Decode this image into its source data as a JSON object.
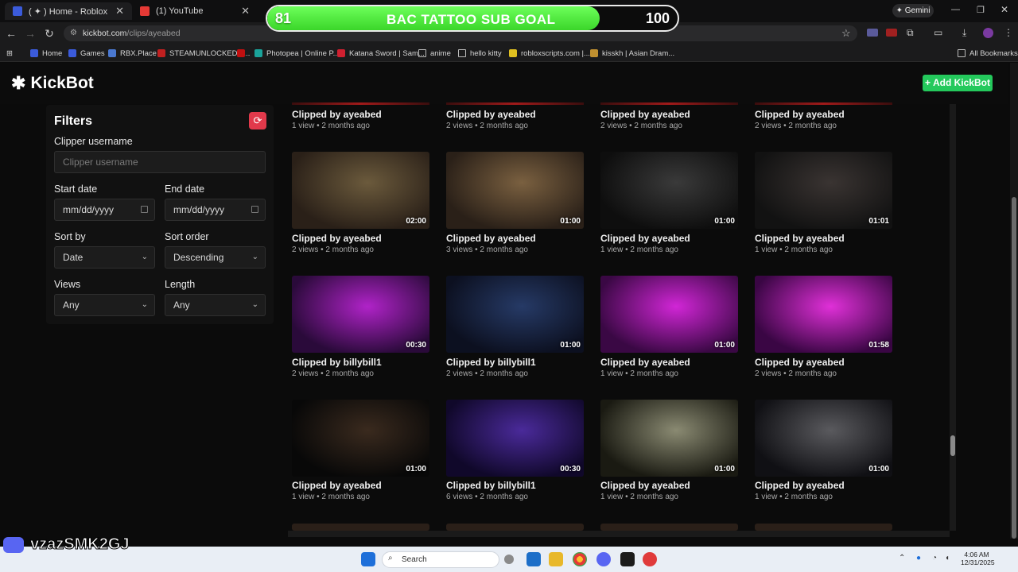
{
  "browser": {
    "tabs": [
      {
        "label": "( ✦ ) Home - Roblox",
        "color": "#3b5bdb"
      },
      {
        "label": "(1) YouTube",
        "color": "#e53935"
      }
    ],
    "url_domain": "kickbot.com",
    "url_path": "/clips/ayeabed",
    "gemini_label": "Gemini",
    "all_bookmarks_label": "All Bookmarks",
    "bookmarks": [
      "Home",
      "Games",
      "RBX.Place",
      "STEAMUNLOCKED »...",
      "Photopea | Online P...",
      "Katana Sword | Sam...",
      "anime",
      "hello kitty",
      "robloxscripts.com |...",
      "kisskh | Asian Dram..."
    ]
  },
  "goal": {
    "current": "81",
    "title": "BAC TATTOO SUB GOAL",
    "max": "100",
    "progress": 0.81
  },
  "app": {
    "name": "KickBot",
    "add_button": "+ Add KickBot"
  },
  "filters": {
    "title": "Filters",
    "clipper_label": "Clipper username",
    "clipper_placeholder": "Clipper username",
    "start_label": "Start date",
    "start_value": "mm/dd/yyyy",
    "end_label": "End date",
    "end_value": "mm/dd/yyyy",
    "sort_by_label": "Sort by",
    "sort_by_value": "Date",
    "sort_order_label": "Sort order",
    "sort_order_value": "Descending",
    "views_label": "Views",
    "views_value": "Any",
    "length_label": "Length",
    "length_value": "Any"
  },
  "clips": [
    {
      "title": "Clipped by ayeabed",
      "meta": "1 view • 2 months ago",
      "duration": ""
    },
    {
      "title": "Clipped by ayeabed",
      "meta": "2 views • 2 months ago",
      "duration": ""
    },
    {
      "title": "Clipped by ayeabed",
      "meta": "2 views • 2 months ago",
      "duration": ""
    },
    {
      "title": "Clipped by ayeabed",
      "meta": "2 views • 2 months ago",
      "duration": ""
    },
    {
      "title": "Clipped by ayeabed",
      "meta": "2 views • 2 months ago",
      "duration": "02:00"
    },
    {
      "title": "Clipped by ayeabed",
      "meta": "3 views • 2 months ago",
      "duration": "01:00"
    },
    {
      "title": "Clipped by ayeabed",
      "meta": "1 view • 2 months ago",
      "duration": "01:00"
    },
    {
      "title": "Clipped by ayeabed",
      "meta": "1 view • 2 months ago",
      "duration": "01:01"
    },
    {
      "title": "Clipped by billybill1",
      "meta": "2 views • 2 months ago",
      "duration": "00:30"
    },
    {
      "title": "Clipped by billybill1",
      "meta": "2 views • 2 months ago",
      "duration": "01:00"
    },
    {
      "title": "Clipped by ayeabed",
      "meta": "1 view • 2 months ago",
      "duration": "01:00"
    },
    {
      "title": "Clipped by ayeabed",
      "meta": "2 views • 2 months ago",
      "duration": "01:58"
    },
    {
      "title": "Clipped by ayeabed",
      "meta": "1 view • 2 months ago",
      "duration": "01:00"
    },
    {
      "title": "Clipped by billybill1",
      "meta": "6 views • 2 months ago",
      "duration": "00:30"
    },
    {
      "title": "Clipped by ayeabed",
      "meta": "1 view • 2 months ago",
      "duration": "01:00"
    },
    {
      "title": "Clipped by ayeabed",
      "meta": "1 view • 2 months ago",
      "duration": "01:00"
    }
  ],
  "thumb_colors": [
    [
      "#2a2018",
      "#6b5a3c"
    ],
    [
      "#2a2018",
      "#7a6040"
    ],
    [
      "#0e0e0e",
      "#3a3a3a"
    ],
    [
      "#121212",
      "#3a3432"
    ],
    [
      "#2a0a3a",
      "#b023c8"
    ],
    [
      "#0c1020",
      "#263a66"
    ],
    [
      "#3a0844",
      "#d126d6"
    ],
    [
      "#3a0644",
      "#e030d8"
    ],
    [
      "#080808",
      "#3a2a1e"
    ],
    [
      "#10082a",
      "#4a2a9a"
    ],
    [
      "#1a1a12",
      "#8a8a72"
    ],
    [
      "#101014",
      "#5a5a5e"
    ]
  ],
  "overlay": {
    "discord_text": "vzazSMK2GJ"
  },
  "taskbar": {
    "search_placeholder": "Search",
    "time": "4:06 AM",
    "date": "12/31/2025"
  }
}
